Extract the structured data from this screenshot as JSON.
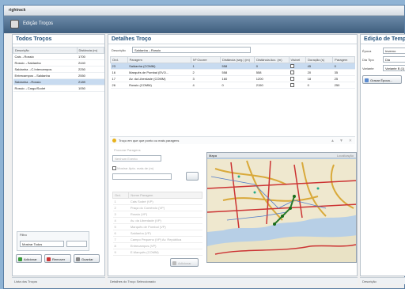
{
  "app": {
    "title": "rightrack",
    "module": "Edição Troços"
  },
  "left_panel": {
    "title": "Todos Troços",
    "columns": [
      "Descrição",
      "Distância (m)"
    ],
    "rows": [
      {
        "desc": "Cais→Rossio",
        "dist": "1700"
      },
      {
        "desc": "Rossio→Saldanha",
        "dist": "2440"
      },
      {
        "desc": "Saldanha→C.Intercampos",
        "dist": "2250"
      },
      {
        "desc": "Entrecampos→Saldanha",
        "dist": "2550"
      },
      {
        "desc": "Saldanha→Rossio",
        "dist": "2189"
      },
      {
        "desc": "Rossio→Cargo/Sodré",
        "dist": "1050"
      }
    ],
    "selected_index": 4,
    "filter_title": "Filtro",
    "filter_value": "Mostrar Todos",
    "buttons": {
      "add": "Adicionar",
      "remove": "Remover",
      "save": "Guardar"
    },
    "status": "Lista dos Troços"
  },
  "center_panel": {
    "title": "Detalhes Troço",
    "desc_label": "Descrição",
    "desc_value": "Saldanha→Rossio",
    "columns": [
      "Ord.",
      "Paragem",
      "Nº Ocorre",
      "Distância (seg.) (m)",
      "Distância Acc. (m)",
      "Visível",
      "Duração (s)",
      "Paragem"
    ],
    "rows": [
      {
        "ord": "23",
        "stop": "Saldanha (COMM)",
        "occ": "1",
        "dseg": "558",
        "dacc": "0",
        "dur": "45",
        "par": "0"
      },
      {
        "ord": "16",
        "stop": "Marquês de Pombal (EVO...",
        "occ": "2",
        "dseg": "558",
        "dacc": "558",
        "dur": "20",
        "par": "35"
      },
      {
        "ord": "17",
        "stop": "Av. da Liberdade (COMM)",
        "occ": "3",
        "dseg": "160",
        "dacc": "1200",
        "dur": "18",
        "par": "25"
      },
      {
        "ord": "26",
        "stop": "Rossio (COMM)",
        "occ": "4",
        "dseg": "0",
        "dacc": "2150",
        "dur": "0",
        "par": "250"
      }
    ],
    "hint": "Troço em que que ponto ou mais paragens",
    "add_stops_label": "Procurar Paragens",
    "search_placeholder": "Nenhum Evento",
    "checkbox_label": "Mostrar Apto. mais de (m)",
    "stop_list_columns": [
      "Ord.",
      "Nome Paragem"
    ],
    "stop_list": [
      {
        "ord": "1",
        "name": "Cais Sodré (VP)"
      },
      {
        "ord": "2",
        "name": "Praça do Comércio (VP)"
      },
      {
        "ord": "3",
        "name": "Rossio (VP)"
      },
      {
        "ord": "4",
        "name": "Av. da Liberdade (VP)"
      },
      {
        "ord": "5",
        "name": "Marquês de Pombal (VP)"
      },
      {
        "ord": "6",
        "name": "Saldanha (VP)"
      },
      {
        "ord": "7",
        "name": "Campo Pequeno (VP) Av. República"
      },
      {
        "ord": "8",
        "name": "Entrecampos (VP)"
      },
      {
        "ord": "9",
        "name": "E.Marquês (COMM)"
      }
    ],
    "add_button": "Adicionar",
    "map_title": "Mapa",
    "map_coords": "Localização",
    "status": "Detalhes do Troço Seleccionado"
  },
  "right_panel": {
    "title": "Edição de Tempo",
    "fields": [
      {
        "label": "Época",
        "value": "Inverno"
      },
      {
        "label": "Dia Tipo",
        "value": "Dia"
      },
      {
        "label": "Variante",
        "value": "Variante B (1)"
      }
    ],
    "button": "Gravar Época...",
    "status": "Descrição"
  }
}
